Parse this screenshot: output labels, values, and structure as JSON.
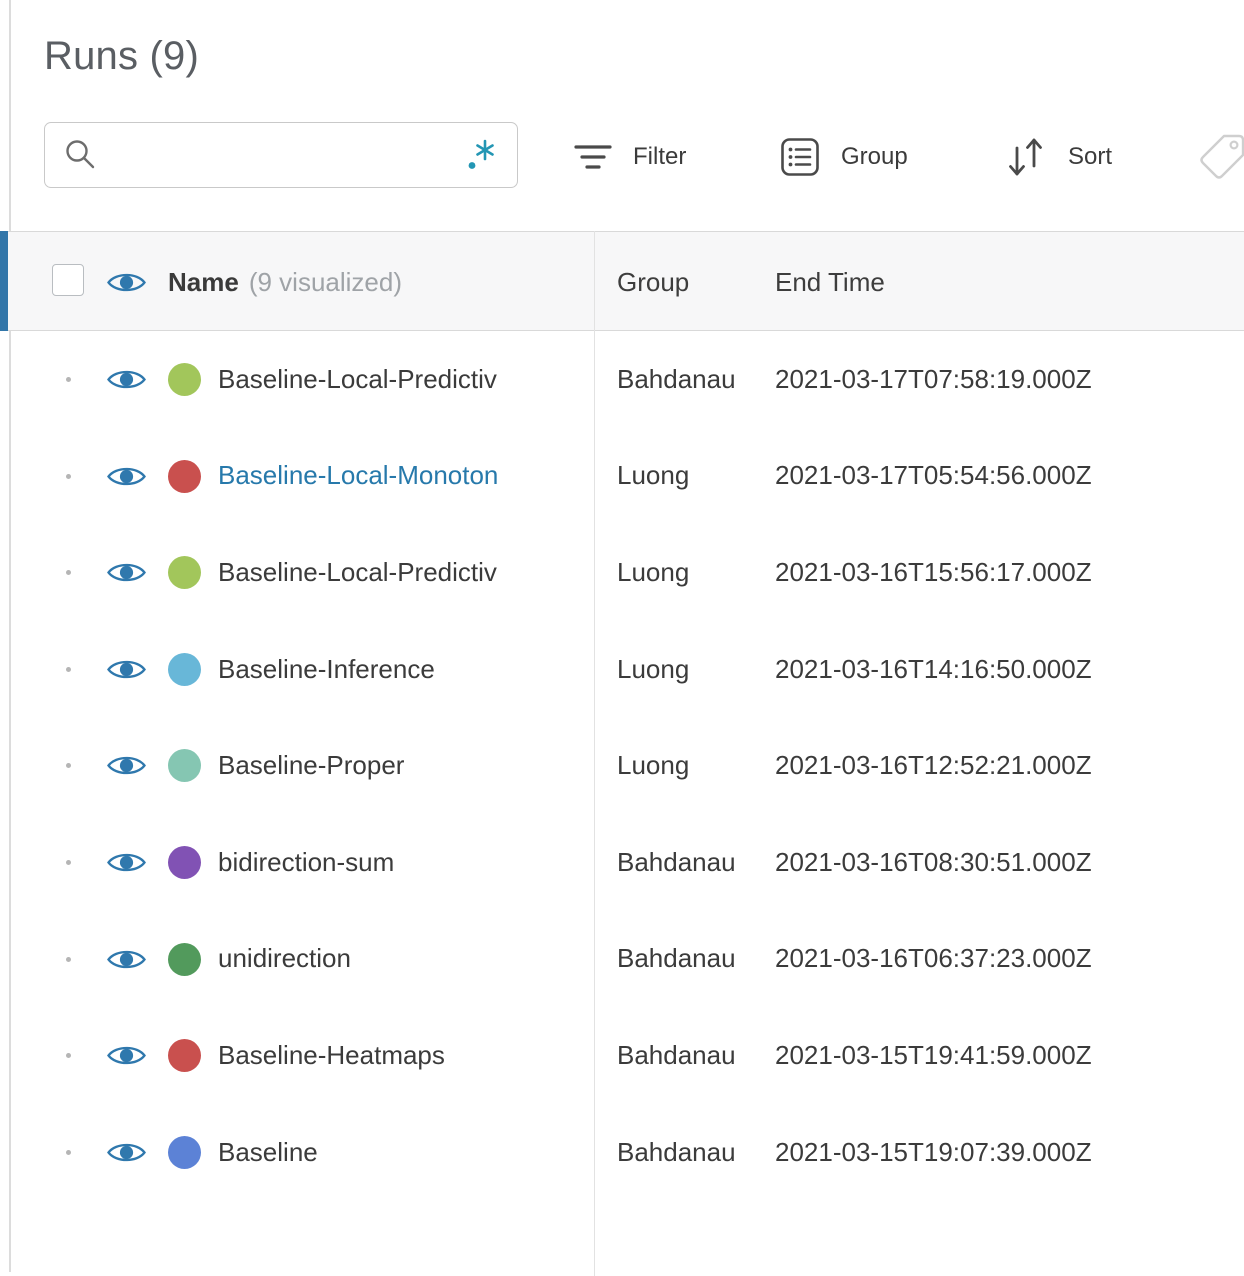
{
  "panel": {
    "title": "Runs (9)"
  },
  "toolbar": {
    "search": {
      "value": "",
      "placeholder": ""
    },
    "filter_label": "Filter",
    "group_label": "Group",
    "sort_label": "Sort"
  },
  "table": {
    "header": {
      "name_label": "Name",
      "name_suffix": "(9 visualized)",
      "group_label": "Group",
      "end_time_label": "End Time"
    },
    "rows": [
      {
        "name": "Baseline-Local-Predictiv",
        "group": "Bahdanau",
        "end_time": "2021-03-17T07:58:19.000Z",
        "dot_color": "#a2c65b",
        "highlighted": false
      },
      {
        "name": "Baseline-Local-Monoton",
        "group": "Luong",
        "end_time": "2021-03-17T05:54:56.000Z",
        "dot_color": "#c9504e",
        "highlighted": true
      },
      {
        "name": "Baseline-Local-Predictiv",
        "group": "Luong",
        "end_time": "2021-03-16T15:56:17.000Z",
        "dot_color": "#a2c65b",
        "highlighted": false
      },
      {
        "name": "Baseline-Inference",
        "group": "Luong",
        "end_time": "2021-03-16T14:16:50.000Z",
        "dot_color": "#68b7d8",
        "highlighted": false
      },
      {
        "name": "Baseline-Proper",
        "group": "Luong",
        "end_time": "2021-03-16T12:52:21.000Z",
        "dot_color": "#85c6b2",
        "highlighted": false
      },
      {
        "name": "bidirection-sum",
        "group": "Bahdanau",
        "end_time": "2021-03-16T08:30:51.000Z",
        "dot_color": "#8152b4",
        "highlighted": false
      },
      {
        "name": "unidirection",
        "group": "Bahdanau",
        "end_time": "2021-03-16T06:37:23.000Z",
        "dot_color": "#529a5c",
        "highlighted": false
      },
      {
        "name": "Baseline-Heatmaps",
        "group": "Bahdanau",
        "end_time": "2021-03-15T19:41:59.000Z",
        "dot_color": "#c9504e",
        "highlighted": false
      },
      {
        "name": "Baseline",
        "group": "Bahdanau",
        "end_time": "2021-03-15T19:07:39.000Z",
        "dot_color": "#5c82d6",
        "highlighted": false
      }
    ]
  },
  "colors": {
    "accent_bar_blue": "#3276a9",
    "eye_blue": "#2f78ad",
    "link_blue": "#2779ab",
    "regex_teal": "#2396b4",
    "header_bg": "#f7f7f8",
    "border_gray": "#d9d9d9",
    "tag_gray": "#cfcfcf"
  },
  "icons": [
    "search-icon",
    "regex-icon",
    "filter-icon",
    "group-icon",
    "sort-icon",
    "tag-icon",
    "visibility-eye-icon",
    "drag-handle-dot"
  ]
}
